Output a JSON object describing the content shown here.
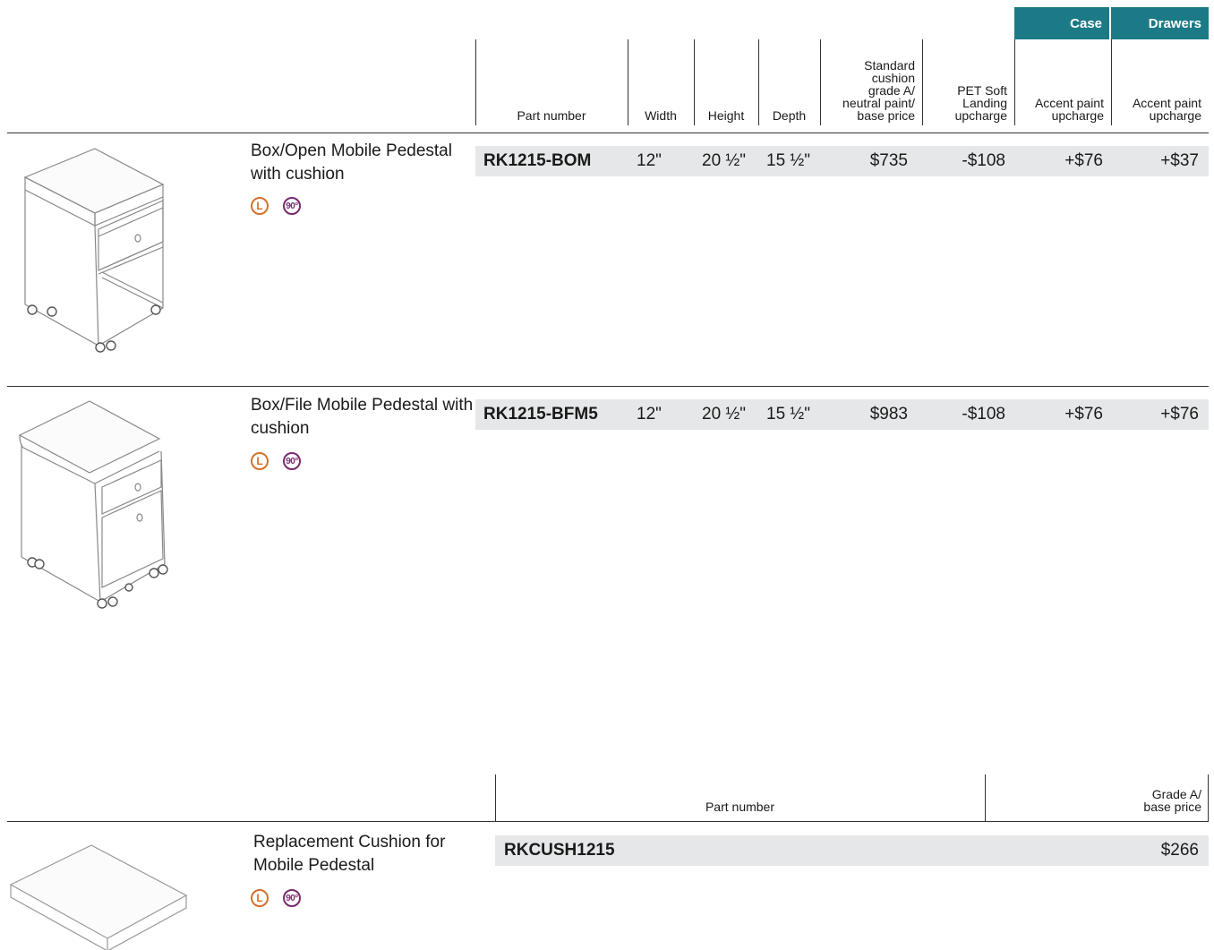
{
  "header": {
    "groups": {
      "case": "Case",
      "drawers": "Drawers"
    },
    "columns": {
      "part_number": "Part number",
      "width": "Width",
      "height": "Height",
      "depth": "Depth",
      "base_price": "Standard\ncushion\ngrade A/\nneutral paint/\nbase price",
      "pet": "PET Soft\nLanding\nupcharge",
      "case_accent": "Accent paint\nupcharge",
      "drawers_accent": "Accent paint\nupcharge"
    }
  },
  "products": [
    {
      "name": "Box/Open Mobile Pedestal with cushion",
      "badges": [
        "L",
        "90°"
      ],
      "part_number": "RK1215-BOM",
      "width": "12\"",
      "height": "20 ½\"",
      "depth": "15 ½\"",
      "base_price": "$735",
      "pet": "-$108",
      "case_accent": "+$76",
      "drawers_accent": "+$37",
      "image_icon": "box-open-pedestal-icon"
    },
    {
      "name": "Box/File Mobile Pedestal with cushion",
      "badges": [
        "L",
        "90°"
      ],
      "part_number": "RK1215-BFM5",
      "width": "12\"",
      "height": "20 ½\"",
      "depth": "15 ½\"",
      "base_price": "$983",
      "pet": "-$108",
      "case_accent": "+$76",
      "drawers_accent": "+$76",
      "image_icon": "box-file-pedestal-icon"
    }
  ],
  "cushion_table": {
    "columns": {
      "part_number": "Part number",
      "price": "Grade A/\nbase price"
    },
    "item": {
      "name": "Replacement Cushion for Mobile Pedestal",
      "badges": [
        "L",
        "90°"
      ],
      "part_number": "RKCUSH1215",
      "price": "$266",
      "image_icon": "cushion-icon"
    }
  },
  "colors": {
    "group_header": "#1b7a86",
    "row_bar": "#e6e7e8",
    "badge_l": "#d4712a",
    "badge_90": "#7a2a6e"
  }
}
